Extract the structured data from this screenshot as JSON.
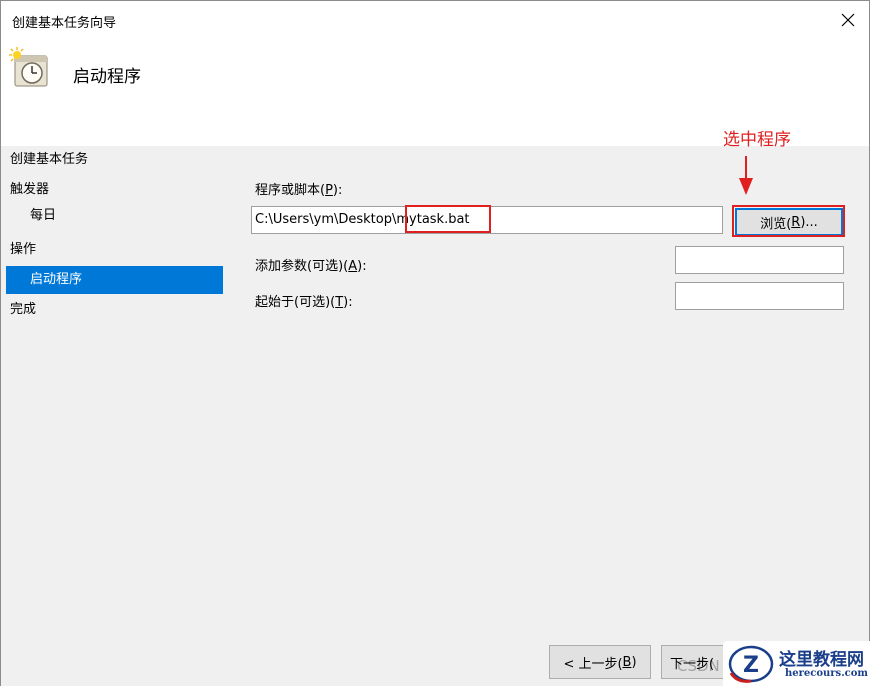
{
  "window": {
    "title": "创建基本任务向导",
    "close_label": "✕"
  },
  "header": {
    "title": "启动程序",
    "icon": "task-clock-icon"
  },
  "nav": {
    "heading": "创建基本任务",
    "trigger": "触发器",
    "daily": "每日",
    "action": "操作",
    "start_program": "启动程序",
    "finish": "完成"
  },
  "form": {
    "program_label_prefix": "程序或脚本(",
    "program_label_key": "P",
    "program_label_suffix": "):",
    "program_value_path": "C:\\Users\\ym\\Desktop\\",
    "program_value_file": "mytask.bat",
    "browse_prefix": "浏览(",
    "browse_key": "R",
    "browse_suffix": ")...",
    "args_label_prefix": "添加参数(可选)(",
    "args_label_key": "A",
    "args_label_suffix": "):",
    "args_value": "",
    "start_in_label_prefix": "起始于(可选)(",
    "start_in_label_key": "T",
    "start_in_label_suffix": "):",
    "start_in_value": ""
  },
  "footer": {
    "back_prefix": "< 上一步(",
    "back_key": "B",
    "back_suffix": ")",
    "next_visible": "下一步("
  },
  "annotation": {
    "text": "选中程序",
    "color": "#e02020"
  },
  "watermark": {
    "site_name": "这里教程网",
    "site_url": "herecours.com",
    "csdn": "CSDN"
  },
  "colors": {
    "selection": "#0078d7",
    "highlight": "#e02020",
    "content_bg": "#f0f0f0"
  }
}
